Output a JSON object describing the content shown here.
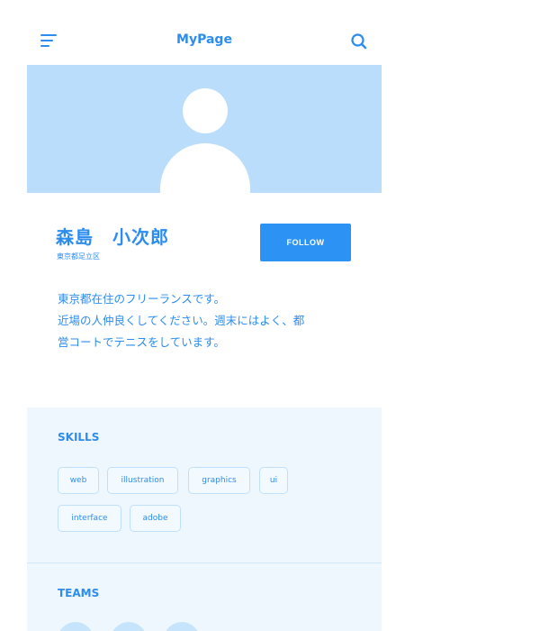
{
  "header": {
    "title": "MyPage",
    "menu_icon": "hamburger-menu-icon",
    "search_icon": "search-icon"
  },
  "profile": {
    "avatar_icon": "user-silhouette-icon",
    "name": "森島　小次郎",
    "location": "東京都足立区",
    "follow_label": "FOLLOW",
    "bio_lines": [
      "東京都在住のフリーランスです。",
      "近場の人仲良くしてください。週末にはよく、都",
      "営コートでテニスをしています。"
    ]
  },
  "skills": {
    "title": "SKILLS",
    "tags": [
      "web",
      "illustration",
      "graphics",
      "ui",
      "interface",
      "adobe"
    ]
  },
  "teams": {
    "title": "TEAMS",
    "member_count_visible": 3
  },
  "colors": {
    "accent": "#2c8cf0",
    "hero_bg": "#b9ddfb",
    "section_bg": "#eef7fe",
    "tag_border": "#bfe0fb"
  }
}
